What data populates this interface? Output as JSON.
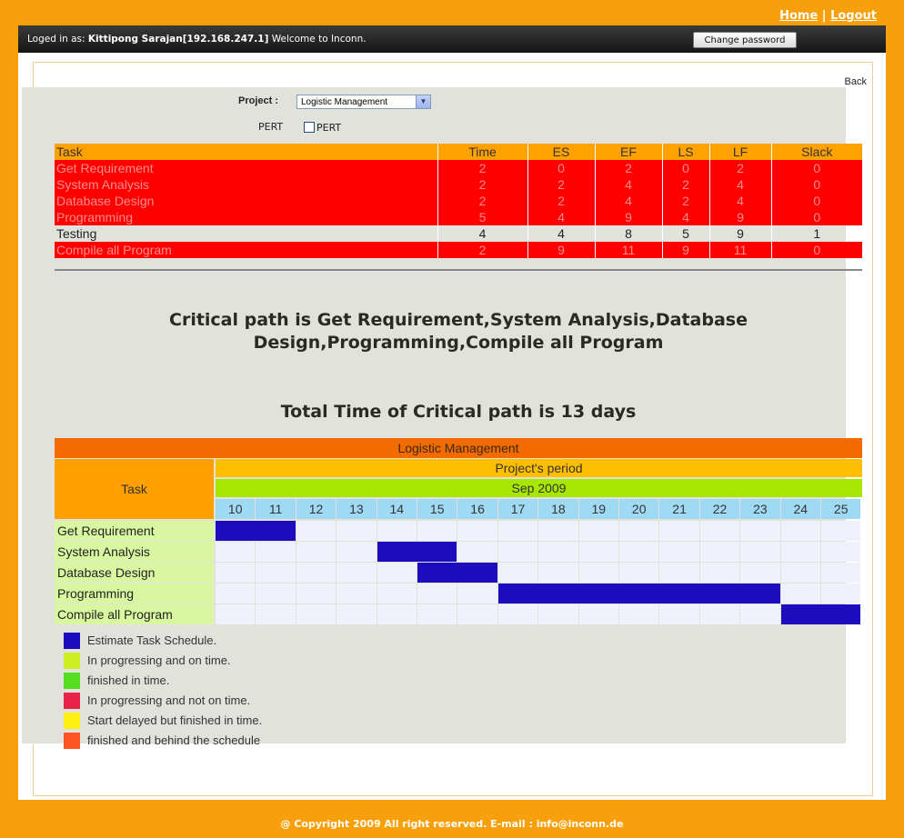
{
  "nav": {
    "home_label": "Home",
    "separator": "|",
    "logout_label": "Logout"
  },
  "login_bar": {
    "prefix": "Loged in as:",
    "user": "Kittipong Sarajan[192.168.247.1]",
    "welcome": "Welcome to Inconn.",
    "change_password_label": "Change password"
  },
  "back_label": "Back",
  "form": {
    "project_label": "Project :",
    "project_value": "Logistic Management",
    "pert_label": "PERT",
    "pert_checkbox_label": "PERT",
    "pert_checked": false
  },
  "cpm_table": {
    "headers": [
      "Task",
      "Time",
      "ES",
      "EF",
      "LS",
      "LF",
      "Slack"
    ],
    "rows": [
      {
        "task": "Get Requirement",
        "time": "2",
        "es": "0",
        "ef": "2",
        "ls": "0",
        "lf": "2",
        "slack": "0",
        "critical": true
      },
      {
        "task": "System Analysis",
        "time": "2",
        "es": "2",
        "ef": "4",
        "ls": "2",
        "lf": "4",
        "slack": "0",
        "critical": true
      },
      {
        "task": "Database Design",
        "time": "2",
        "es": "2",
        "ef": "4",
        "ls": "2",
        "lf": "4",
        "slack": "0",
        "critical": true
      },
      {
        "task": "Programming",
        "time": "5",
        "es": "4",
        "ef": "9",
        "ls": "4",
        "lf": "9",
        "slack": "0",
        "critical": true
      },
      {
        "task": "Testing",
        "time": "4",
        "es": "4",
        "ef": "8",
        "ls": "5",
        "lf": "9",
        "slack": "1",
        "critical": false
      },
      {
        "task": "Compile all Program",
        "time": "2",
        "es": "9",
        "ef": "11",
        "ls": "9",
        "lf": "11",
        "slack": "0",
        "critical": true
      }
    ]
  },
  "critical_path_text": "Critical path is Get Requirement,System Analysis,Database Design,Programming,Compile all Program",
  "total_time_text": "Total Time of Critical path is 13 days",
  "gantt": {
    "title": "Logistic Management",
    "task_header": "Task",
    "period_label": "Project's period",
    "month_label": "Sep 2009",
    "days": [
      "10",
      "11",
      "12",
      "13",
      "14",
      "15",
      "16",
      "17",
      "18",
      "19",
      "20",
      "21",
      "22",
      "23",
      "24",
      "25"
    ],
    "tasks": [
      {
        "name": "Get Requirement",
        "start_day": "10",
        "end_day": "11"
      },
      {
        "name": "System Analysis",
        "start_day": "14",
        "end_day": "15"
      },
      {
        "name": "Database Design",
        "start_day": "15",
        "end_day": "16"
      },
      {
        "name": "Programming",
        "start_day": "17",
        "end_day": "23"
      },
      {
        "name": "Compile all Program",
        "start_day": "24",
        "end_day": "25"
      }
    ],
    "bar_color": "#1c0cbe"
  },
  "legend": [
    {
      "label": "Estimate Task Schedule.",
      "color": "#1c0cbe"
    },
    {
      "label": "In progressing and on time.",
      "color": "#ccee22"
    },
    {
      "label": "finished in time.",
      "color": "#55dd22"
    },
    {
      "label": "In progressing and not on time.",
      "color": "#e8244a"
    },
    {
      "label": "Start delayed but finished in time.",
      "color": "#ffee11"
    },
    {
      "label": "finished and behind the schedule",
      "color": "#ff5522"
    }
  ],
  "footer_text": "@ Copyright 2009 All right reserved. E-mail : info@inconn.de"
}
